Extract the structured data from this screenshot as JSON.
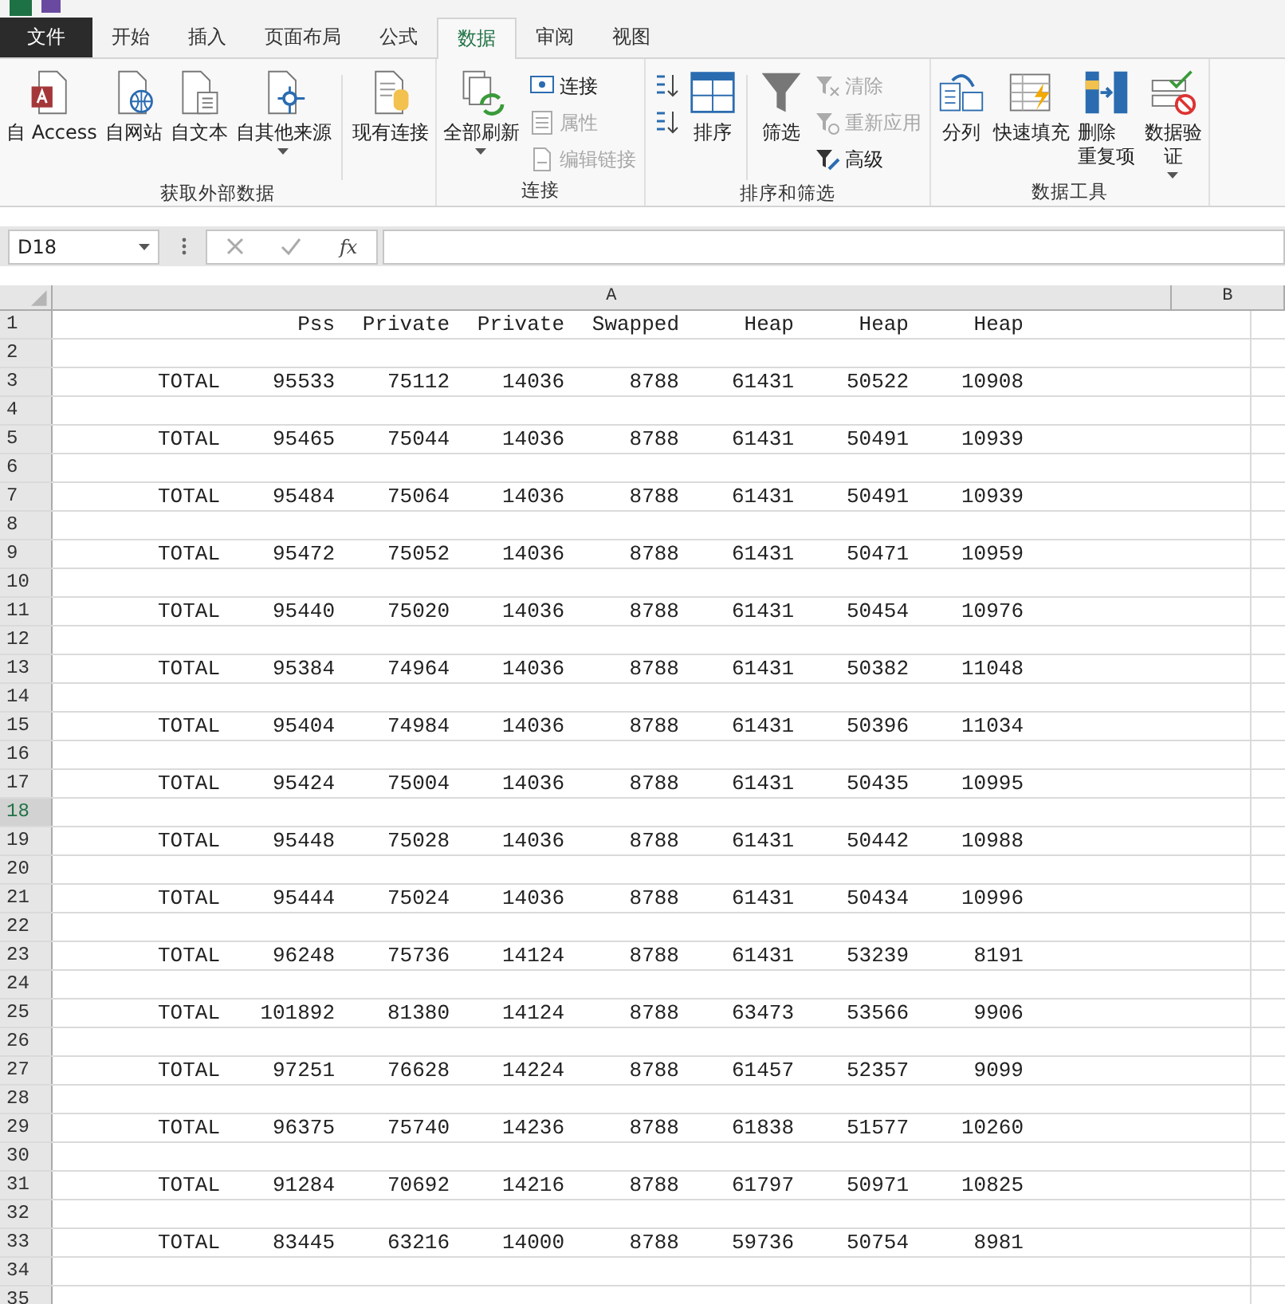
{
  "tabs": [
    {
      "label": "文件",
      "kind": "file",
      "selected": false
    },
    {
      "label": "开始",
      "kind": "tab",
      "selected": false
    },
    {
      "label": "插入",
      "kind": "tab",
      "selected": false
    },
    {
      "label": "页面布局",
      "kind": "tab",
      "selected": false
    },
    {
      "label": "公式",
      "kind": "tab",
      "selected": false
    },
    {
      "label": "数据",
      "kind": "tab",
      "selected": true
    },
    {
      "label": "审阅",
      "kind": "tab",
      "selected": false
    },
    {
      "label": "视图",
      "kind": "tab",
      "selected": false
    }
  ],
  "ribbon_groups": [
    {
      "label": "获取外部数据",
      "items": [
        {
          "kind": "large",
          "label": "自 Access"
        },
        {
          "kind": "large",
          "label": "自网站"
        },
        {
          "kind": "large",
          "label": "自文本"
        },
        {
          "kind": "large",
          "label": "自其他来源",
          "dropdown": true
        },
        {
          "kind": "separator"
        },
        {
          "kind": "large",
          "label": "现有连接"
        }
      ]
    },
    {
      "label": "连接",
      "items": [
        {
          "kind": "large",
          "label": "全部刷新",
          "dropdown": true
        },
        {
          "kind": "stack",
          "entries": [
            {
              "label": "连接",
              "disabled": false
            },
            {
              "label": "属性",
              "disabled": true
            },
            {
              "label": "编辑链接",
              "disabled": true
            }
          ]
        }
      ]
    },
    {
      "label": "排序和筛选",
      "items": [
        {
          "kind": "sort-pair"
        },
        {
          "kind": "large",
          "label": "排序"
        },
        {
          "kind": "separator"
        },
        {
          "kind": "large",
          "label": "筛选"
        },
        {
          "kind": "stack",
          "entries": [
            {
              "label": "清除",
              "disabled": true
            },
            {
              "label": "重新应用",
              "disabled": true
            },
            {
              "label": "高级",
              "disabled": false
            }
          ]
        }
      ]
    },
    {
      "label": "数据工具",
      "items": [
        {
          "kind": "large",
          "label": "分列"
        },
        {
          "kind": "large",
          "label": "快速填充"
        },
        {
          "kind": "large",
          "label": "删除重复项"
        },
        {
          "kind": "large",
          "label": "数据验证",
          "dropdown": true
        }
      ]
    }
  ],
  "formula_bar": {
    "name_box": "D18",
    "fx": "fx"
  },
  "columns": [
    "A",
    "B"
  ],
  "rows": [
    {
      "n": "1",
      "selected": false,
      "values": [
        "Pss",
        "Private",
        "Private",
        "Swapped",
        "Heap",
        "Heap",
        "Heap"
      ]
    },
    {
      "n": "2",
      "selected": false
    },
    {
      "n": "3",
      "selected": false,
      "label": "TOTAL",
      "values": [
        "95533",
        "75112",
        "14036",
        "8788",
        "61431",
        "50522",
        "10908"
      ]
    },
    {
      "n": "4",
      "selected": false
    },
    {
      "n": "5",
      "selected": false,
      "label": "TOTAL",
      "values": [
        "95465",
        "75044",
        "14036",
        "8788",
        "61431",
        "50491",
        "10939"
      ]
    },
    {
      "n": "6",
      "selected": false
    },
    {
      "n": "7",
      "selected": false,
      "label": "TOTAL",
      "values": [
        "95484",
        "75064",
        "14036",
        "8788",
        "61431",
        "50491",
        "10939"
      ]
    },
    {
      "n": "8",
      "selected": false
    },
    {
      "n": "9",
      "selected": false,
      "label": "TOTAL",
      "values": [
        "95472",
        "75052",
        "14036",
        "8788",
        "61431",
        "50471",
        "10959"
      ]
    },
    {
      "n": "10",
      "selected": false
    },
    {
      "n": "11",
      "selected": false,
      "label": "TOTAL",
      "values": [
        "95440",
        "75020",
        "14036",
        "8788",
        "61431",
        "50454",
        "10976"
      ]
    },
    {
      "n": "12",
      "selected": false
    },
    {
      "n": "13",
      "selected": false,
      "label": "TOTAL",
      "values": [
        "95384",
        "74964",
        "14036",
        "8788",
        "61431",
        "50382",
        "11048"
      ]
    },
    {
      "n": "14",
      "selected": false
    },
    {
      "n": "15",
      "selected": false,
      "label": "TOTAL",
      "values": [
        "95404",
        "74984",
        "14036",
        "8788",
        "61431",
        "50396",
        "11034"
      ]
    },
    {
      "n": "16",
      "selected": false
    },
    {
      "n": "17",
      "selected": false,
      "label": "TOTAL",
      "values": [
        "95424",
        "75004",
        "14036",
        "8788",
        "61431",
        "50435",
        "10995"
      ]
    },
    {
      "n": "18",
      "selected": true
    },
    {
      "n": "19",
      "selected": false,
      "label": "TOTAL",
      "values": [
        "95448",
        "75028",
        "14036",
        "8788",
        "61431",
        "50442",
        "10988"
      ]
    },
    {
      "n": "20",
      "selected": false
    },
    {
      "n": "21",
      "selected": false,
      "label": "TOTAL",
      "values": [
        "95444",
        "75024",
        "14036",
        "8788",
        "61431",
        "50434",
        "10996"
      ]
    },
    {
      "n": "22",
      "selected": false
    },
    {
      "n": "23",
      "selected": false,
      "label": "TOTAL",
      "values": [
        "96248",
        "75736",
        "14124",
        "8788",
        "61431",
        "53239",
        "8191"
      ]
    },
    {
      "n": "24",
      "selected": false
    },
    {
      "n": "25",
      "selected": false,
      "label": "TOTAL",
      "values": [
        "101892",
        "81380",
        "14124",
        "8788",
        "63473",
        "53566",
        "9906"
      ]
    },
    {
      "n": "26",
      "selected": false
    },
    {
      "n": "27",
      "selected": false,
      "label": "TOTAL",
      "values": [
        "97251",
        "76628",
        "14224",
        "8788",
        "61457",
        "52357",
        "9099"
      ]
    },
    {
      "n": "28",
      "selected": false
    },
    {
      "n": "29",
      "selected": false,
      "label": "TOTAL",
      "values": [
        "96375",
        "75740",
        "14236",
        "8788",
        "61838",
        "51577",
        "10260"
      ]
    },
    {
      "n": "30",
      "selected": false
    },
    {
      "n": "31",
      "selected": false,
      "label": "TOTAL",
      "values": [
        "91284",
        "70692",
        "14216",
        "8788",
        "61797",
        "50971",
        "10825"
      ]
    },
    {
      "n": "32",
      "selected": false
    },
    {
      "n": "33",
      "selected": false,
      "label": "TOTAL",
      "values": [
        "83445",
        "63216",
        "14000",
        "8788",
        "59736",
        "50754",
        "8981"
      ]
    },
    {
      "n": "34",
      "selected": false
    },
    {
      "n": "35",
      "selected": false
    }
  ]
}
